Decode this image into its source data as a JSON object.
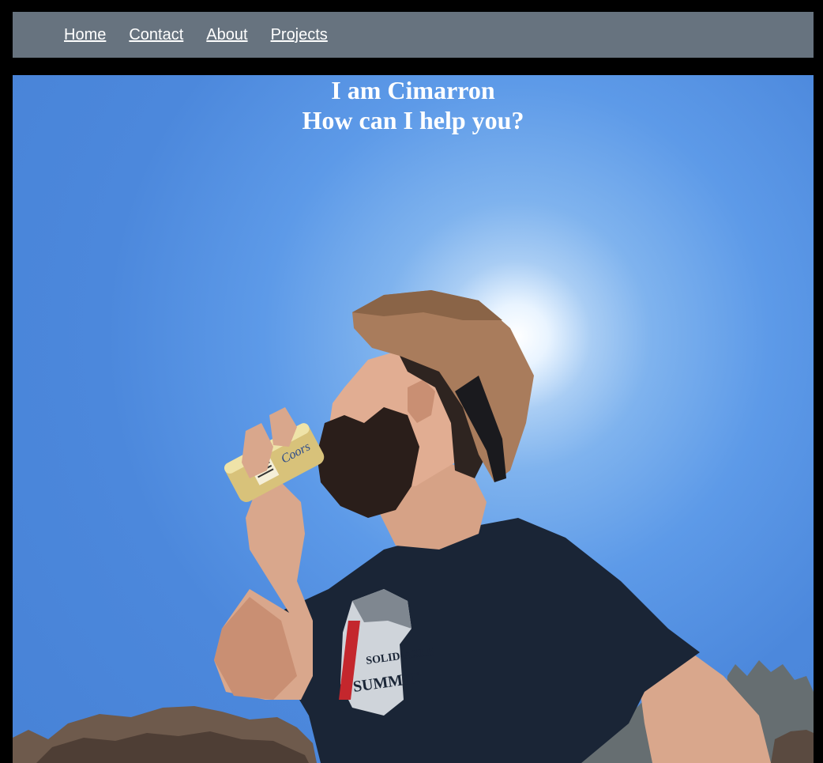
{
  "nav": {
    "items": [
      {
        "label": "Home"
      },
      {
        "label": "Contact"
      },
      {
        "label": "About"
      },
      {
        "label": "Projects"
      }
    ]
  },
  "hero": {
    "line1": "I am Cimarron",
    "line2": "How can I help you?"
  },
  "colors": {
    "page_background": "#000000",
    "navbar_background": "#67737f",
    "nav_link": "#ffffff",
    "hero_text": "#ffffff",
    "sky": "#4c88dc"
  }
}
